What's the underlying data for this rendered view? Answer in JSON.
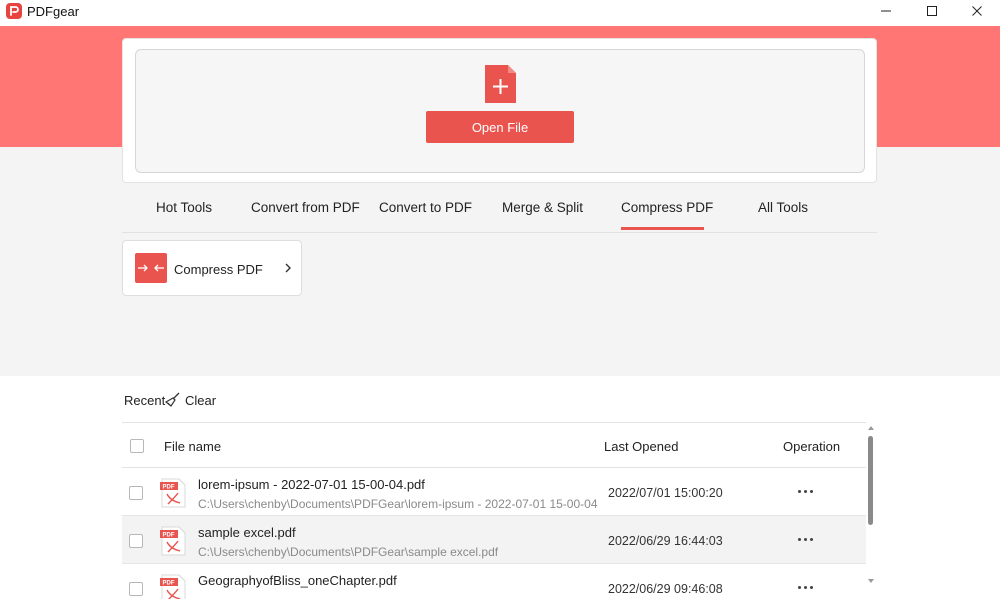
{
  "window": {
    "title": "PDFgear"
  },
  "open_card": {
    "open_button_label": "Open File"
  },
  "tabs": [
    {
      "label": "Hot Tools"
    },
    {
      "label": "Convert from PDF"
    },
    {
      "label": "Convert to PDF"
    },
    {
      "label": "Merge & Split"
    },
    {
      "label": "Compress PDF",
      "active": true
    },
    {
      "label": "All Tools"
    }
  ],
  "tools": [
    {
      "label": "Compress PDF"
    }
  ],
  "recent": {
    "label": "Recent",
    "clear_label": "Clear"
  },
  "table": {
    "headers": {
      "file_name": "File name",
      "last_opened": "Last Opened",
      "operation": "Operation"
    },
    "rows": [
      {
        "name": "lorem-ipsum - 2022-07-01 15-00-04.pdf",
        "path": "C:\\Users\\chenby\\Documents\\PDFGear\\lorem-ipsum - 2022-07-01 15-00-04",
        "last_opened": "2022/07/01 15:00:20"
      },
      {
        "name": "sample excel.pdf",
        "path": "C:\\Users\\chenby\\Documents\\PDFGear\\sample excel.pdf",
        "last_opened": "2022/06/29 16:44:03"
      },
      {
        "name": "GeographyofBliss_oneChapter.pdf",
        "path": "",
        "last_opened": "2022/06/29 09:46:08"
      }
    ]
  },
  "icons": {
    "logo": "pdfgear-logo",
    "file_add": "file-plus-icon",
    "compress": "compress-icon",
    "clear": "broom-icon",
    "pdf_file": "pdf-file-icon",
    "more": "more-icon"
  },
  "colors": {
    "accent": "#e9544f",
    "hero": "#ff7675",
    "background": "#f4f4f4"
  }
}
